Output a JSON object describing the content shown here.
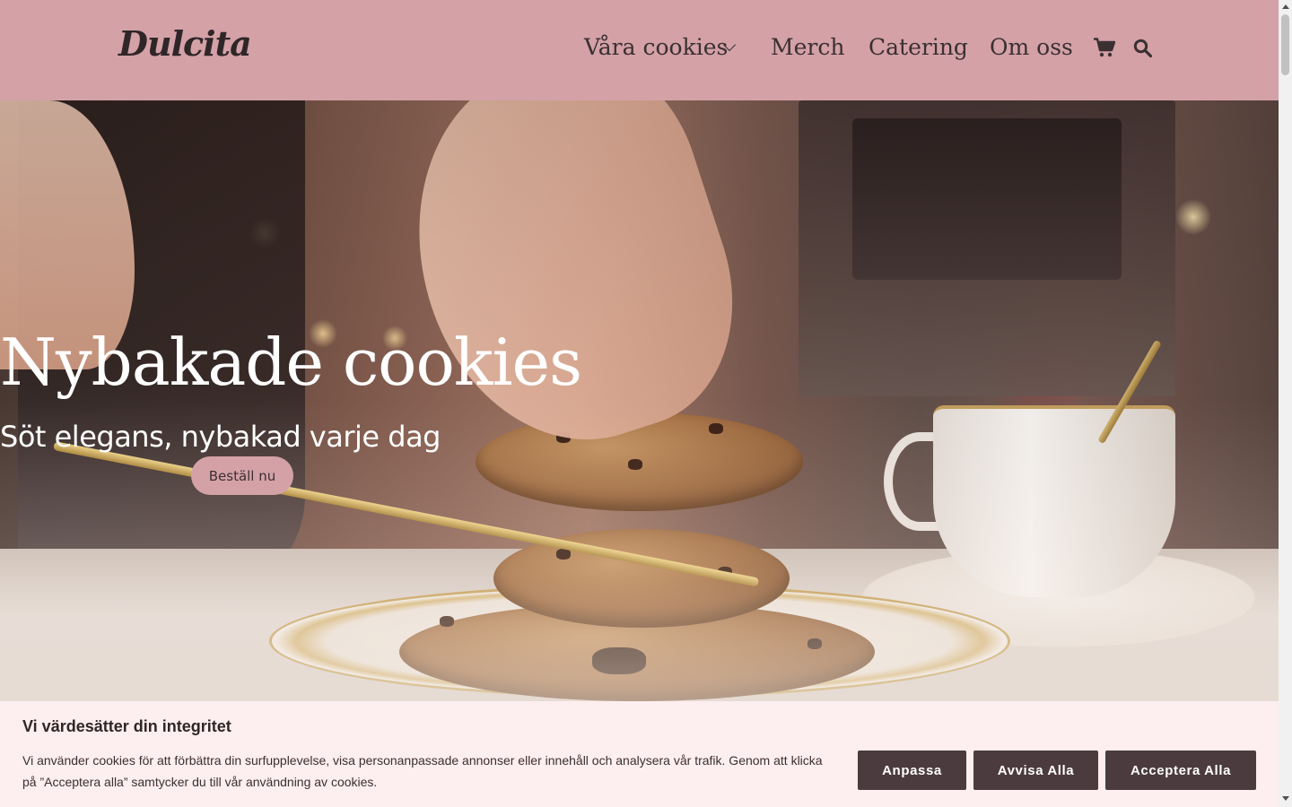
{
  "header": {
    "logo": "Dulcita",
    "nav": [
      {
        "label": "Våra cookies",
        "has_dropdown": true
      },
      {
        "label": "Merch"
      },
      {
        "label": "Catering"
      },
      {
        "label": "Om oss"
      }
    ],
    "icons": [
      "cart-icon",
      "search-icon"
    ],
    "background_color": "#d4a1a7"
  },
  "hero": {
    "title": "Nybakade cookies",
    "subtitle": "Söt elegans, nybakad varje dag",
    "cta_label": "Beställ nu"
  },
  "consent": {
    "title": "Vi värdesätter din integritet",
    "text": "Vi använder cookies för att förbättra din surfupplevelse, visa personanpassade annonser eller innehåll och analysera vår trafik. Genom att klicka på ”Acceptera alla” samtycker du till vår användning av cookies.",
    "buttons": {
      "customize": "Anpassa",
      "reject": "Avvisa Alla",
      "accept": "Acceptera Alla"
    },
    "background_color": "#fdeeef",
    "button_color": "#4b3b3e"
  }
}
